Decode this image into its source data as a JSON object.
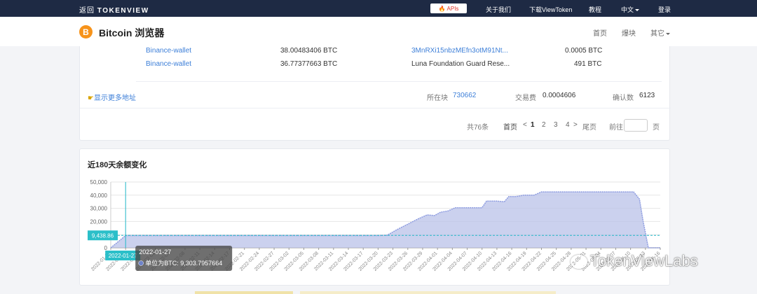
{
  "topbar": {
    "brand_prefix": "返回",
    "brand_name": "TOKENVIEW",
    "apis_label": "APIs",
    "about": "关于我们",
    "download": "下载ViewToken",
    "tutorial": "教程",
    "language": "中文",
    "login": "登录"
  },
  "header": {
    "logo_letter": "B",
    "title": "Bitcoin 浏览器",
    "nav_home": "首页",
    "nav_blocks": "爆块",
    "nav_other": "其它"
  },
  "transfers": [
    {
      "from": "Binance-wallet",
      "from_amount": "38.00483406 BTC",
      "to": "3MnRXi15nbzMEfn3otM91Nt...",
      "to_amount": "0.0005 BTC"
    },
    {
      "from": "Binance-wallet",
      "from_amount": "36.77377663 BTC",
      "to": "Luna Foundation Guard Rese...",
      "to_amount": "491 BTC"
    }
  ],
  "tx_footer": {
    "show_more": "显示更多地址",
    "block_label": "所在块",
    "block_value": "730662",
    "fee_label": "交易费",
    "fee_value": "0.0004606",
    "confirm_label": "确认数",
    "confirm_value": "6123"
  },
  "pagination": {
    "total": "共76条",
    "first": "首页",
    "prev": "<",
    "pages": [
      "1",
      "2",
      "3",
      "4"
    ],
    "next": ">",
    "last": "尾页",
    "goto": "前往",
    "page_unit": "页",
    "input_value": ""
  },
  "chart_section_title": "近180天余额变化",
  "chart_data": {
    "type": "area",
    "title": "近180天余额变化",
    "ylim": [
      0,
      50000
    ],
    "yticks": [
      "50,000",
      "40,000",
      "30,000",
      "20,000",
      "10,000",
      "0"
    ],
    "x_labels": [
      "2022-01-24",
      "2022-01-27",
      "2022-01-30",
      "2022-02-02",
      "2022-02-05",
      "2022-02-08",
      "2022-02-11",
      "2022-02-14",
      "2022-02-17",
      "2022-02-21",
      "2022-02-24",
      "2022-02-27",
      "2022-03-02",
      "2022-03-05",
      "2022-03-08",
      "2022-03-11",
      "2022-03-14",
      "2022-03-17",
      "2022-03-20",
      "2022-03-23",
      "2022-03-26",
      "2022-03-29",
      "2022-04-01",
      "2022-04-04",
      "2022-04-07",
      "2022-04-10",
      "2022-04-13",
      "2022-04-16",
      "2022-04-19",
      "2022-04-22",
      "2022-04-25",
      "2022-04-28",
      "2022-05-01",
      "2022-05-04",
      "2022-05-07",
      "2022-05-10",
      "2022-05-13",
      "2022-05-16"
    ],
    "series": [
      {
        "points": [
          [
            0,
            0
          ],
          [
            1,
            9300
          ],
          [
            2,
            9300
          ],
          [
            4,
            9300
          ],
          [
            6,
            9300
          ],
          [
            8,
            9300
          ],
          [
            10,
            9300
          ],
          [
            12,
            9300
          ],
          [
            14,
            9300
          ],
          [
            16,
            9300
          ],
          [
            18,
            9300
          ],
          [
            18.6,
            9500
          ],
          [
            19.3,
            14000
          ],
          [
            20,
            18000
          ],
          [
            20.7,
            22000
          ],
          [
            21.3,
            25000
          ],
          [
            21.8,
            24500
          ],
          [
            22.2,
            27000
          ],
          [
            22.7,
            28000
          ],
          [
            23.2,
            30500
          ],
          [
            23.8,
            30500
          ],
          [
            24.5,
            30500
          ],
          [
            25,
            30500
          ],
          [
            25.3,
            35500
          ],
          [
            26,
            35500
          ],
          [
            26.5,
            35000
          ],
          [
            26.8,
            39000
          ],
          [
            27.3,
            39000
          ],
          [
            27.8,
            40000
          ],
          [
            28.5,
            40000
          ],
          [
            29,
            42500
          ],
          [
            30,
            42500
          ],
          [
            31,
            42500
          ],
          [
            32,
            42500
          ],
          [
            33,
            42500
          ],
          [
            34,
            42500
          ],
          [
            34.8,
            42500
          ],
          [
            35.2,
            42500
          ],
          [
            35.6,
            37000
          ],
          [
            35.85,
            20000
          ],
          [
            36.2,
            0
          ],
          [
            37,
            0
          ]
        ]
      }
    ],
    "crosshair": {
      "date": "2022-01-27",
      "value_label": "9,438.86"
    },
    "tooltip": {
      "date": "2022-01-27",
      "text": "单位为BTC: 9,303.7957664"
    },
    "colors": {
      "area": "#b9c2e8",
      "line": "#8c9be0",
      "crosshair": "#22b8c8",
      "label_bg": "#2bbfc9"
    }
  },
  "watermark": "TokenViewLabs"
}
